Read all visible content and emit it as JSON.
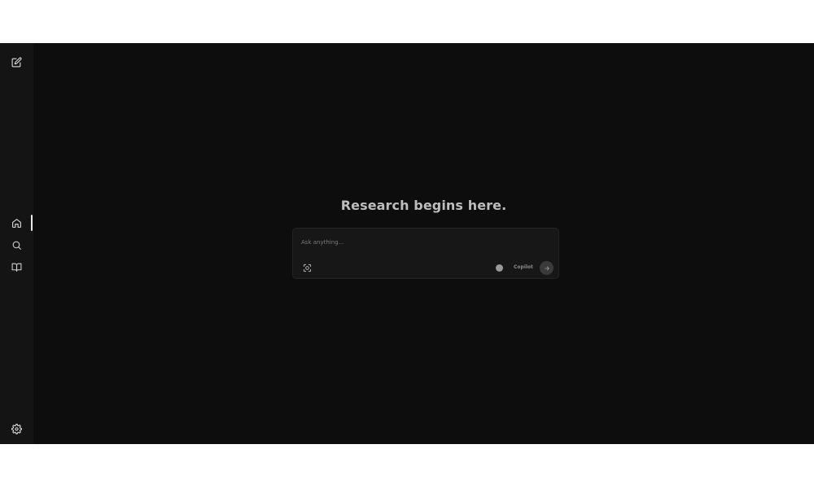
{
  "sidebar": {
    "items": [
      {
        "name": "new-thread",
        "icon": "edit-icon"
      },
      {
        "name": "home",
        "icon": "home-icon",
        "active": true
      },
      {
        "name": "discover",
        "icon": "search-icon"
      },
      {
        "name": "library",
        "icon": "book-open-icon"
      },
      {
        "name": "settings",
        "icon": "gear-icon"
      }
    ]
  },
  "main": {
    "headline": "Research begins here.",
    "composer": {
      "placeholder": "Ask anything...",
      "value": "",
      "focus_icon": "focus-icon",
      "copilot_label": "Copilot",
      "copilot_enabled": false,
      "send_icon": "arrow-right-icon"
    }
  },
  "colors": {
    "background": "#0d0d0d",
    "sidebar": "#141414",
    "composer": "#171717",
    "headline": "#bdbdbd"
  }
}
